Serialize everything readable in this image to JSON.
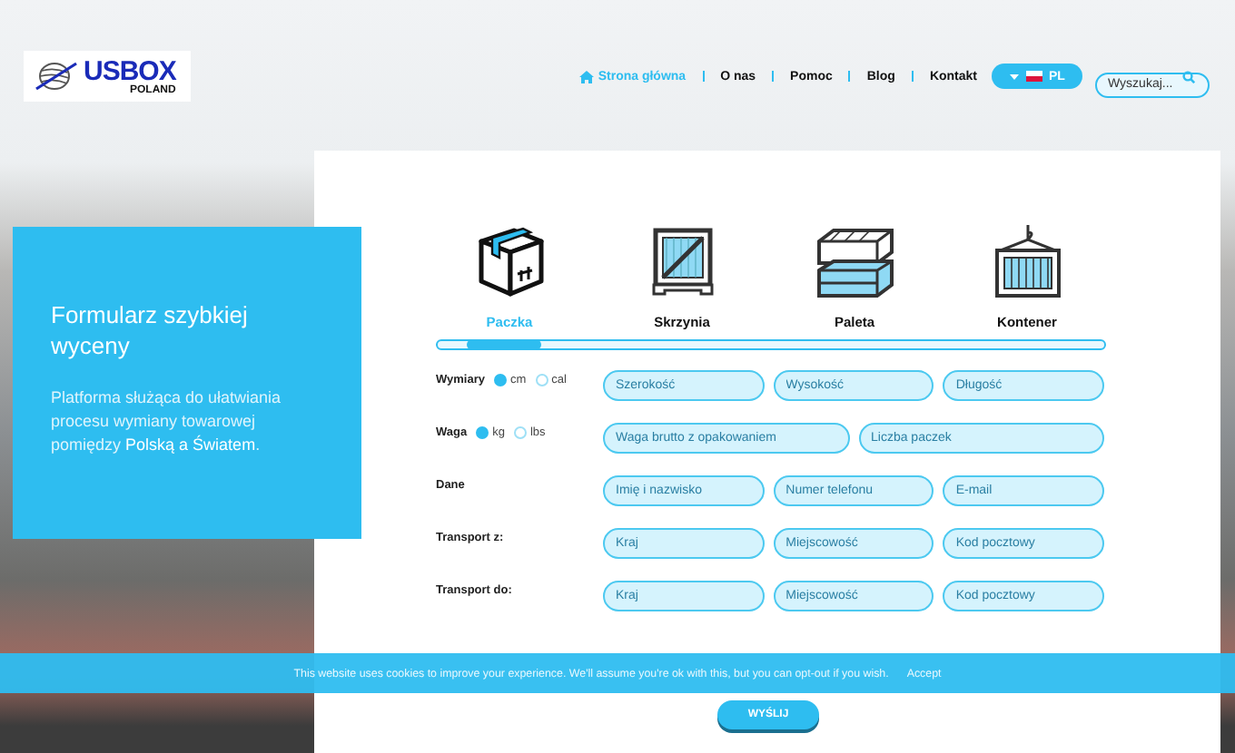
{
  "header": {
    "logo": {
      "brand": "USBOX",
      "sub": "POLAND"
    },
    "nav": [
      {
        "label": "Strona główna",
        "selected": true
      },
      {
        "label": "O nas",
        "selected": false
      },
      {
        "label": "Pomoc",
        "selected": false
      },
      {
        "label": "Blog",
        "selected": false
      },
      {
        "label": "Kontakt",
        "selected": false
      }
    ],
    "language": {
      "code": "PL"
    },
    "search": {
      "placeholder": "Wyszukaj..."
    }
  },
  "hero": {
    "title": "Formularz szybkiej wyceny",
    "description": "Platforma służąca do ułatwiania procesu wymiany towarowej pomiędzy **Polską a Światem**."
  },
  "form": {
    "types": [
      {
        "label": "Paczka",
        "kind": "parcel",
        "selected": true
      },
      {
        "label": "Skrzynia",
        "kind": "crate",
        "selected": false
      },
      {
        "label": "Paleta",
        "kind": "pallet",
        "selected": false
      },
      {
        "label": "Kontener",
        "kind": "container",
        "selected": false
      }
    ],
    "rows": [
      {
        "label": "Wymiary",
        "units": [
          {
            "label": "cm",
            "selected": true
          },
          {
            "label": "cal",
            "selected": false
          }
        ],
        "fields": [
          {
            "placeholder": "Szerokość"
          },
          {
            "placeholder": "Wysokość"
          },
          {
            "placeholder": "Długość"
          }
        ]
      },
      {
        "label": "Waga",
        "units": [
          {
            "label": "kg",
            "selected": true
          },
          {
            "label": "lbs",
            "selected": false
          }
        ],
        "fields": [
          {
            "placeholder": "Waga brutto z opakowaniem"
          },
          {
            "placeholder": "Liczba paczek"
          }
        ]
      },
      {
        "label": "Dane",
        "fields": [
          {
            "placeholder": "Imię i nazwisko"
          },
          {
            "placeholder": "Numer telefonu"
          },
          {
            "placeholder": "E-mail"
          }
        ]
      },
      {
        "label": "Transport z:",
        "fields": [
          {
            "placeholder": "Kraj"
          },
          {
            "placeholder": "Miejscowość"
          },
          {
            "placeholder": "Kod pocztowy"
          }
        ]
      },
      {
        "label": "Transport do:",
        "fields": [
          {
            "placeholder": "Kraj"
          },
          {
            "placeholder": "Miejscowość"
          },
          {
            "placeholder": "Kod pocztowy"
          }
        ]
      }
    ],
    "submit": "WYŚLIJ"
  },
  "cookie": {
    "text": "This website uses cookies to improve your experience. We'll assume you're ok with this, but you can opt-out if you wish.",
    "accept": "Accept"
  }
}
